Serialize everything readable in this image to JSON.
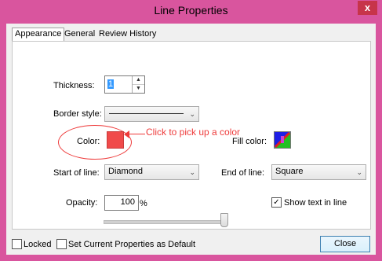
{
  "window": {
    "title": "Line Properties",
    "close_glyph": "x"
  },
  "tabs": [
    {
      "label": "Appearance",
      "active": true
    },
    {
      "label": "General",
      "active": false
    },
    {
      "label": "Review History",
      "active": false
    }
  ],
  "thickness": {
    "label": "Thickness:",
    "value": "1"
  },
  "border_style": {
    "label": "Border style:"
  },
  "color": {
    "label": "Color:",
    "value": "#f04a4a"
  },
  "fill_color": {
    "label": "Fill color:"
  },
  "annotation": {
    "text": "Click to pick up a color",
    "color": "#ee3b3b"
  },
  "start_of_line": {
    "label": "Start of line:",
    "value": "Diamond"
  },
  "end_of_line": {
    "label": "End of line:",
    "value": "Square"
  },
  "opacity": {
    "label": "Opacity:",
    "value": "100",
    "unit": "%",
    "slider_level": 1.0
  },
  "show_text_in_line": {
    "label": "Show text in line",
    "checked": true,
    "check_glyph": "✓"
  },
  "locked": {
    "label": "Locked",
    "checked": false
  },
  "set_default": {
    "label": "Set Current Properties as Default",
    "checked": false
  },
  "close_button": {
    "label": "Close"
  },
  "spinner": {
    "up": "▲",
    "down": "▼"
  },
  "dropdown_arrow": "⌄"
}
